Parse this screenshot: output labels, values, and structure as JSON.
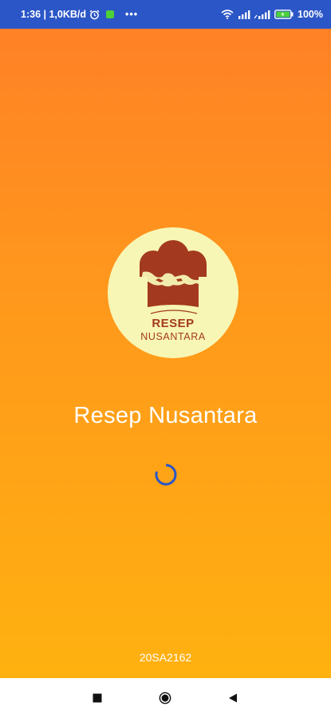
{
  "status_bar": {
    "time_speed": "1:36 | 1,0KB/d",
    "more": "•••",
    "battery": "100%",
    "icons": [
      "alarm-icon",
      "app-notification-icon",
      "wifi-icon",
      "signal-icon",
      "signal-icon",
      "battery-icon"
    ]
  },
  "logo": {
    "word1": "RESEP",
    "word2": "NUSANTARA",
    "colors": {
      "circle": "#F7F6B4",
      "hat": "#A33A1F"
    }
  },
  "app": {
    "title": "Resep Nusantara",
    "version": "20SA2162"
  },
  "colors": {
    "gradient_top": "#FF7F27",
    "gradient_bottom": "#FFB40F",
    "spinner": "#2B56C7"
  },
  "nav_bar": {
    "buttons": [
      "recent-apps",
      "home",
      "back"
    ]
  }
}
